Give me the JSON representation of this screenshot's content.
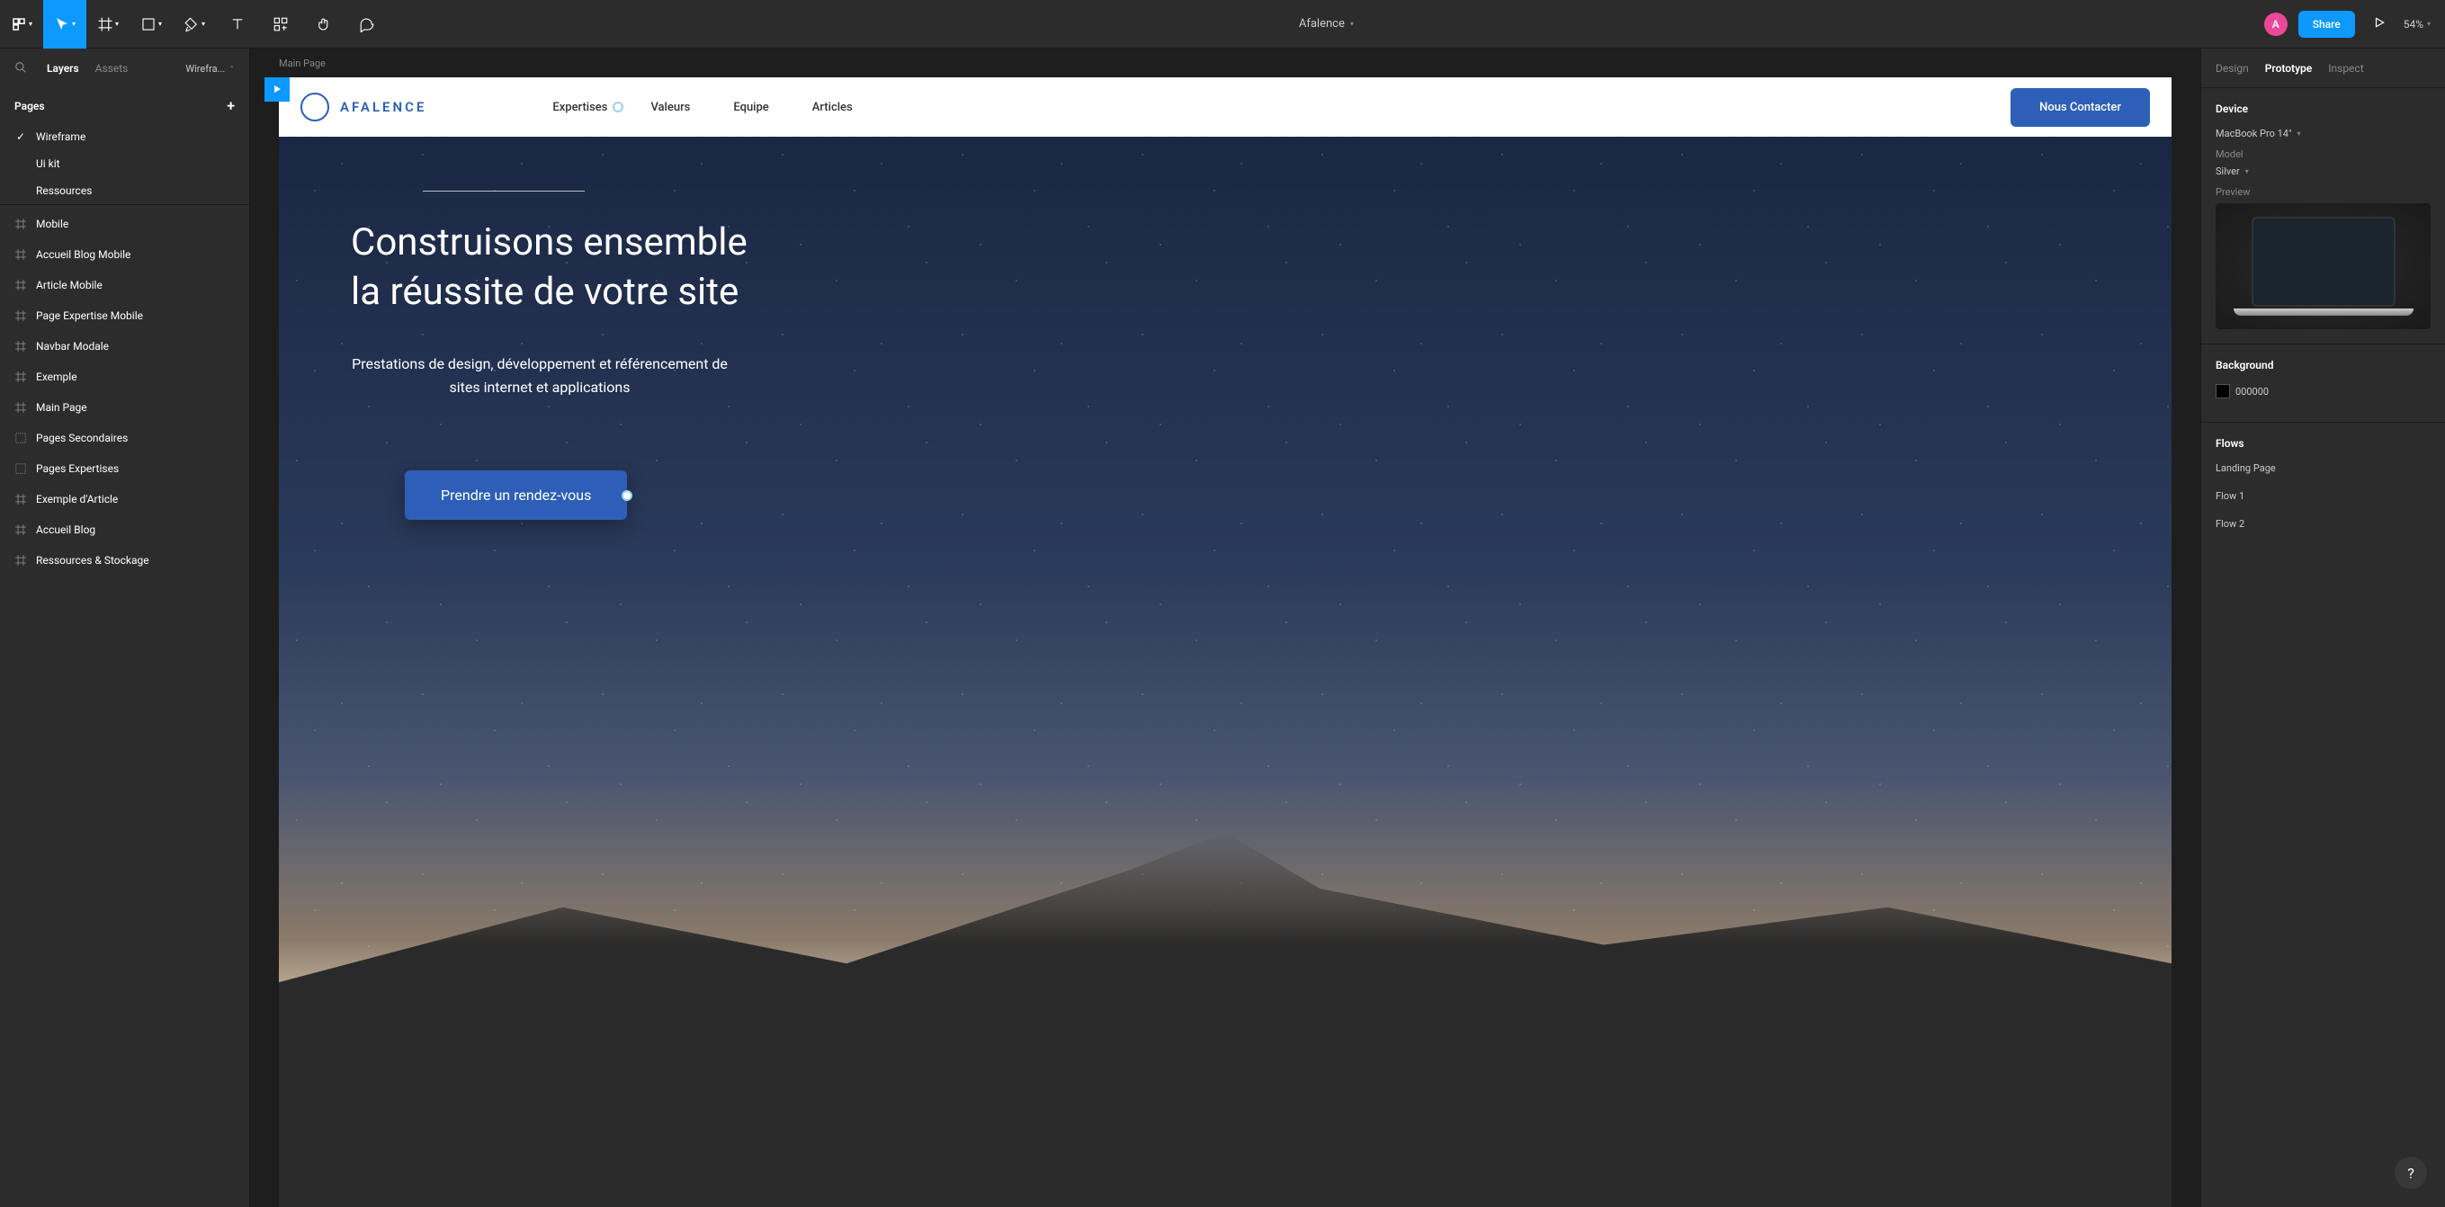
{
  "toolbar": {
    "file_name": "Afalence",
    "avatar_letter": "A",
    "share_label": "Share",
    "zoom": "54%"
  },
  "left_panel": {
    "tabs": {
      "layers": "Layers",
      "assets": "Assets"
    },
    "page_dropdown": "Wirefra...",
    "pages_header": "Pages",
    "pages": [
      {
        "name": "Wireframe",
        "selected": true
      },
      {
        "name": "Ui kit",
        "selected": false
      },
      {
        "name": "Ressources",
        "selected": false
      }
    ],
    "layers": [
      {
        "name": "Mobile",
        "type": "frame"
      },
      {
        "name": "Accueil Blog Mobile",
        "type": "frame"
      },
      {
        "name": "Article Mobile",
        "type": "frame"
      },
      {
        "name": "Page Expertise Mobile",
        "type": "frame"
      },
      {
        "name": "Navbar Modale",
        "type": "frame"
      },
      {
        "name": "Exemple",
        "type": "frame"
      },
      {
        "name": "Main Page",
        "type": "frame"
      },
      {
        "name": "Pages Secondaires",
        "type": "section"
      },
      {
        "name": "Pages Expertises",
        "type": "section"
      },
      {
        "name": "Exemple d'Article",
        "type": "frame"
      },
      {
        "name": "Accueil Blog",
        "type": "frame"
      },
      {
        "name": "Ressources & Stockage",
        "type": "frame"
      }
    ]
  },
  "canvas": {
    "frame_label": "Main Page",
    "logo_text": "AFALENCE",
    "nav_links": [
      "Expertises",
      "Valeurs",
      "Equipe",
      "Articles"
    ],
    "nav_cta": "Nous Contacter",
    "hero_title_line1": "Construisons ensemble",
    "hero_title_line2": "la réussite de votre site",
    "hero_subtitle": "Prestations de design, développement et référencement de sites internet et applications",
    "hero_cta": "Prendre un rendez-vous"
  },
  "right_panel": {
    "tabs": {
      "design": "Design",
      "prototype": "Prototype",
      "inspect": "Inspect"
    },
    "device": {
      "title": "Device",
      "name": "MacBook Pro 14\"",
      "model_label": "Model",
      "model_value": "Silver",
      "preview_label": "Preview"
    },
    "background": {
      "title": "Background",
      "value": "000000"
    },
    "flows": {
      "title": "Flows",
      "items": [
        "Landing Page",
        "Flow 1",
        "Flow 2"
      ]
    }
  }
}
